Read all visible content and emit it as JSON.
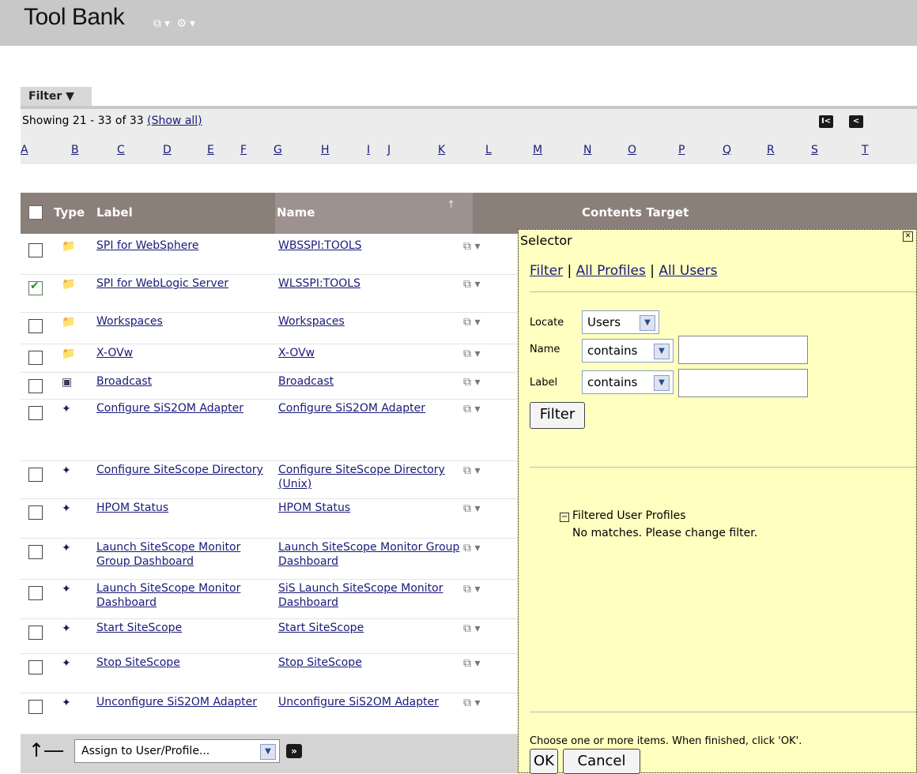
{
  "header": {
    "title": "Tool Bank",
    "icons": [
      "window-icon",
      "chevron-down-icon",
      "gear-icon",
      "chevron-down-icon"
    ]
  },
  "filter": {
    "tab_label": "Filter",
    "showing_text": "Showing 21 - 33 of 33",
    "show_all_label": "(Show all)"
  },
  "alphabet": [
    "A",
    "B",
    "C",
    "D",
    "E",
    "F",
    "G",
    "H",
    "I",
    "J",
    "K",
    "L",
    "M",
    "N",
    "O",
    "P",
    "Q",
    "R",
    "S",
    "T"
  ],
  "table": {
    "columns": [
      "Type",
      "Label",
      "Name",
      "Contents",
      "Target"
    ],
    "rows": [
      {
        "checked": false,
        "type": "folder-tool",
        "label": "SPI for WebSphere",
        "name": "WBSSPI:TOOLS"
      },
      {
        "checked": true,
        "type": "folder-tool",
        "label": "SPI for WebLogic Server",
        "name": "WLSSPI:TOOLS"
      },
      {
        "checked": false,
        "type": "folder-tool",
        "label": "Workspaces",
        "name": "Workspaces"
      },
      {
        "checked": false,
        "type": "folder-tool",
        "label": "X-OVw",
        "name": "X-OVw"
      },
      {
        "checked": false,
        "type": "broadcast-tool",
        "label": "Broadcast",
        "name": "Broadcast"
      },
      {
        "checked": false,
        "type": "wrench-tool",
        "label": "Configure SiS2OM Adapter",
        "name": "Configure SiS2OM Adapter"
      },
      {
        "checked": false,
        "type": "wrench-tool",
        "label": "Configure SiteScope Directory",
        "name": "Configure SiteScope Directory (Unix)"
      },
      {
        "checked": false,
        "type": "wrench-tool",
        "label": "HPOM Status",
        "name": "HPOM Status"
      },
      {
        "checked": false,
        "type": "wrench-tool",
        "label": "Launch SiteScope Monitor Group Dashboard",
        "name": "Launch SiteScope Monitor Group Dashboard"
      },
      {
        "checked": false,
        "type": "wrench-tool",
        "label": "Launch SiteScope Monitor Dashboard",
        "name": "SiS Launch SiteScope Monitor Dashboard"
      },
      {
        "checked": false,
        "type": "wrench-tool",
        "label": "Start SiteScope",
        "name": "Start SiteScope"
      },
      {
        "checked": false,
        "type": "wrench-tool",
        "label": "Stop SiteScope",
        "name": "Stop SiteScope"
      },
      {
        "checked": false,
        "type": "wrench-tool",
        "label": "Unconfigure SiS2OM Adapter",
        "name": "Unconfigure SiS2OM Adapter"
      }
    ]
  },
  "bottom": {
    "action_select": "Assign to User/Profile..."
  },
  "selector": {
    "title": "Selector",
    "links": [
      "Filter",
      "All Profiles",
      "All Users"
    ],
    "locate_label": "Locate",
    "locate_value": "Users",
    "name_label": "Name",
    "name_op": "contains",
    "label_label": "Label",
    "label_op": "contains",
    "filter_button": "Filter",
    "tree_header": "Filtered User Profiles",
    "empty_message": "No matches. Please change filter.",
    "instructions": "Choose one or more items. When finished, click 'OK'.",
    "ok_button": "OK",
    "cancel_button": "Cancel"
  }
}
